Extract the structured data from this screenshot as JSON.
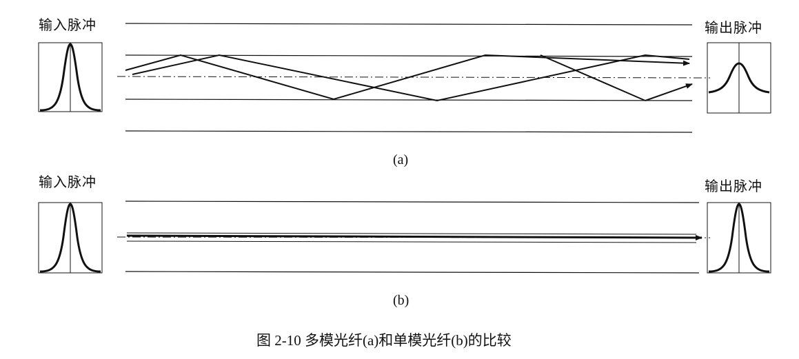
{
  "diagram_a": {
    "input_label": "输入脉冲",
    "output_label": "输出脉冲",
    "sublabel": "(a)"
  },
  "diagram_b": {
    "input_label": "输入脉冲",
    "output_label": "输出脉冲",
    "sublabel": "(b)"
  },
  "caption": "图 2-10    多模光纤(a)和单模光纤(b)的比较",
  "colors": {
    "ink": "#111111",
    "background": "#ffffff"
  }
}
